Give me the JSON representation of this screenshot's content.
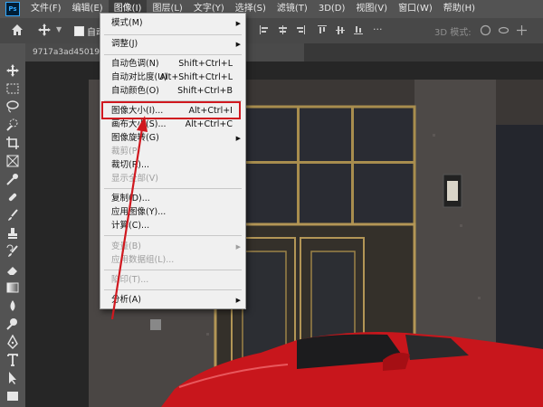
{
  "app": {
    "logo": "Ps"
  },
  "menubar": {
    "items": [
      {
        "label": "文件(F)"
      },
      {
        "label": "编辑(E)"
      },
      {
        "label": "图像(I)"
      },
      {
        "label": "图层(L)"
      },
      {
        "label": "文字(Y)"
      },
      {
        "label": "选择(S)"
      },
      {
        "label": "滤镜(T)"
      },
      {
        "label": "3D(D)"
      },
      {
        "label": "视图(V)"
      },
      {
        "label": "窗口(W)"
      },
      {
        "label": "帮助(H)"
      }
    ]
  },
  "options_bar": {
    "auto_select_label": "自动",
    "mode_3d_label": "3D 模式:"
  },
  "document": {
    "tab_title": "9717a3ad450196f"
  },
  "image_menu": {
    "items": [
      {
        "label": "模式(M)",
        "shortcut": "",
        "submenu": true,
        "disabled": false
      },
      {
        "label": "调整(J)",
        "shortcut": "",
        "submenu": true,
        "disabled": false
      },
      {
        "label": "自动色调(N)",
        "shortcut": "Shift+Ctrl+L",
        "submenu": false,
        "disabled": false
      },
      {
        "label": "自动对比度(U)",
        "shortcut": "Alt+Shift+Ctrl+L",
        "submenu": false,
        "disabled": false
      },
      {
        "label": "自动颜色(O)",
        "shortcut": "Shift+Ctrl+B",
        "submenu": false,
        "disabled": false
      },
      {
        "label": "图像大小(I)...",
        "shortcut": "Alt+Ctrl+I",
        "submenu": false,
        "disabled": false
      },
      {
        "label": "画布大小(S)...",
        "shortcut": "Alt+Ctrl+C",
        "submenu": false,
        "disabled": false
      },
      {
        "label": "图像旋转(G)",
        "shortcut": "",
        "submenu": true,
        "disabled": false
      },
      {
        "label": "裁剪(P)",
        "shortcut": "",
        "submenu": false,
        "disabled": true
      },
      {
        "label": "裁切(R)...",
        "shortcut": "",
        "submenu": false,
        "disabled": false
      },
      {
        "label": "显示全部(V)",
        "shortcut": "",
        "submenu": false,
        "disabled": true
      },
      {
        "label": "复制(D)...",
        "shortcut": "",
        "submenu": false,
        "disabled": false
      },
      {
        "label": "应用图像(Y)...",
        "shortcut": "",
        "submenu": false,
        "disabled": false
      },
      {
        "label": "计算(C)...",
        "shortcut": "",
        "submenu": false,
        "disabled": false
      },
      {
        "label": "变量(B)",
        "shortcut": "",
        "submenu": true,
        "disabled": true
      },
      {
        "label": "应用数据组(L)...",
        "shortcut": "",
        "submenu": false,
        "disabled": true
      },
      {
        "label": "陷印(T)...",
        "shortcut": "",
        "submenu": false,
        "disabled": true
      },
      {
        "label": "分析(A)",
        "shortcut": "",
        "submenu": true,
        "disabled": false
      }
    ]
  },
  "colors": {
    "accent_red": "#d0181f",
    "menu_bg": "#f0f0f0",
    "chrome": "#535353",
    "car_red": "#c8161c"
  }
}
